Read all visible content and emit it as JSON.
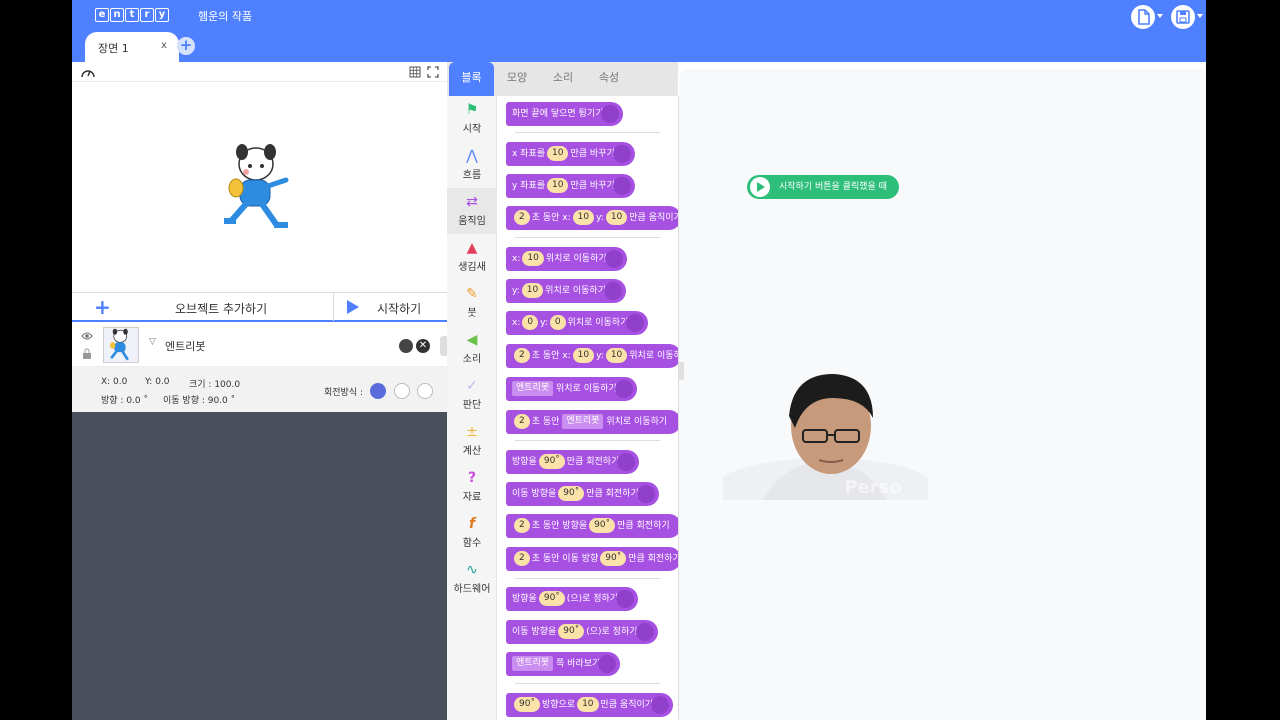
{
  "header": {
    "logo_letters": [
      "e",
      "n",
      "t",
      "r",
      "y"
    ],
    "project_title": "햄운의 작품",
    "scene_tab": "장면 1",
    "scene_close": "x",
    "add_scene": "+"
  },
  "stage": {
    "add_object": "오브젝트 추가하기",
    "start": "시작하기"
  },
  "object": {
    "name": "엔트리봇",
    "x": "X: 0.0",
    "y": "Y: 0.0",
    "size": "크기 : 100.0",
    "direction": "방향 : 0.0 ˚",
    "move_direction": "이동 방향 : 90.0 ˚",
    "rotation_label": "회전방식 :"
  },
  "panel_tabs": [
    "블록",
    "모양",
    "소리",
    "속성"
  ],
  "categories": [
    {
      "label": "시작",
      "icon": "flag-icon",
      "color": "#2dbe7a"
    },
    {
      "label": "흐름",
      "icon": "flow-icon",
      "color": "#4f80ff"
    },
    {
      "label": "움직임",
      "icon": "arrows-icon",
      "color": "#a751e3"
    },
    {
      "label": "생김새",
      "icon": "shapes-icon",
      "color": "#e0415e"
    },
    {
      "label": "붓",
      "icon": "brush-icon",
      "color": "#f0a030"
    },
    {
      "label": "소리",
      "icon": "speaker-icon",
      "color": "#6cc04a"
    },
    {
      "label": "판단",
      "icon": "check-icon",
      "color": "#c7b8f0"
    },
    {
      "label": "계산",
      "icon": "calc-icon",
      "color": "#f2b53b"
    },
    {
      "label": "자료",
      "icon": "question-icon",
      "color": "#cb4fe0"
    },
    {
      "label": "함수",
      "icon": "function-icon",
      "color": "#e07a1f"
    },
    {
      "label": "하드웨어",
      "icon": "wave-icon",
      "color": "#21a39b"
    }
  ],
  "blocks": {
    "b1": "화면 끝에 닿으면 튕기기",
    "b2a": "x 좌표를",
    "b2v": "10",
    "b2b": "만큼 바꾸기",
    "b3a": "y 좌표를",
    "b3v": "10",
    "b3b": "만큼 바꾸기",
    "b4v1": "2",
    "b4a": "초 동안 x:",
    "b4v2": "10",
    "b4b": "y:",
    "b4v3": "10",
    "b4c": "만큼 움직이기",
    "b5a": "x:",
    "b5v": "10",
    "b5b": "위치로 이동하기",
    "b6a": "y:",
    "b6v": "10",
    "b6b": "위치로 이동하기",
    "b7a": "x:",
    "b7v1": "0",
    "b7b": "y:",
    "b7v2": "0",
    "b7c": "위치로 이동하기",
    "b8v1": "2",
    "b8a": "초 동안 x:",
    "b8v2": "10",
    "b8b": "y:",
    "b8v3": "10",
    "b8c": "위치로 이동하기",
    "b9o": "엔트리봇",
    "b9a": "위치로 이동하기",
    "b10v": "2",
    "b10a": "초 동안",
    "b10o": "엔트리봇",
    "b10b": "위치로 이동하기",
    "b11a": "방향을",
    "b11v": "90˚",
    "b11b": "만큼 회전하기",
    "b12a": "이동 방향을",
    "b12v": "90˚",
    "b12b": "만큼 회전하기",
    "b13v1": "2",
    "b13a": "초 동안 방향을",
    "b13v2": "90˚",
    "b13b": "만큼 회전하기",
    "b14v1": "2",
    "b14a": "초 동안 이동 방향",
    "b14v2": "90˚",
    "b14b": "만큼 회전하기",
    "b15a": "방향을",
    "b15v": "90˚",
    "b15b": "(으)로 정하기",
    "b16a": "이동 방향을",
    "b16v": "90˚",
    "b16b": "(으)로 정하기",
    "b17o": "엔트리봇",
    "b17a": "쪽 바라보기",
    "b18v1": "90˚",
    "b18a": "방향으로",
    "b18v2": "10",
    "b18b": "만큼 움직이기"
  },
  "workspace": {
    "start_block": "시작하기 버튼을 클릭했을 때"
  },
  "webcam": {
    "watermark": "Perso"
  }
}
